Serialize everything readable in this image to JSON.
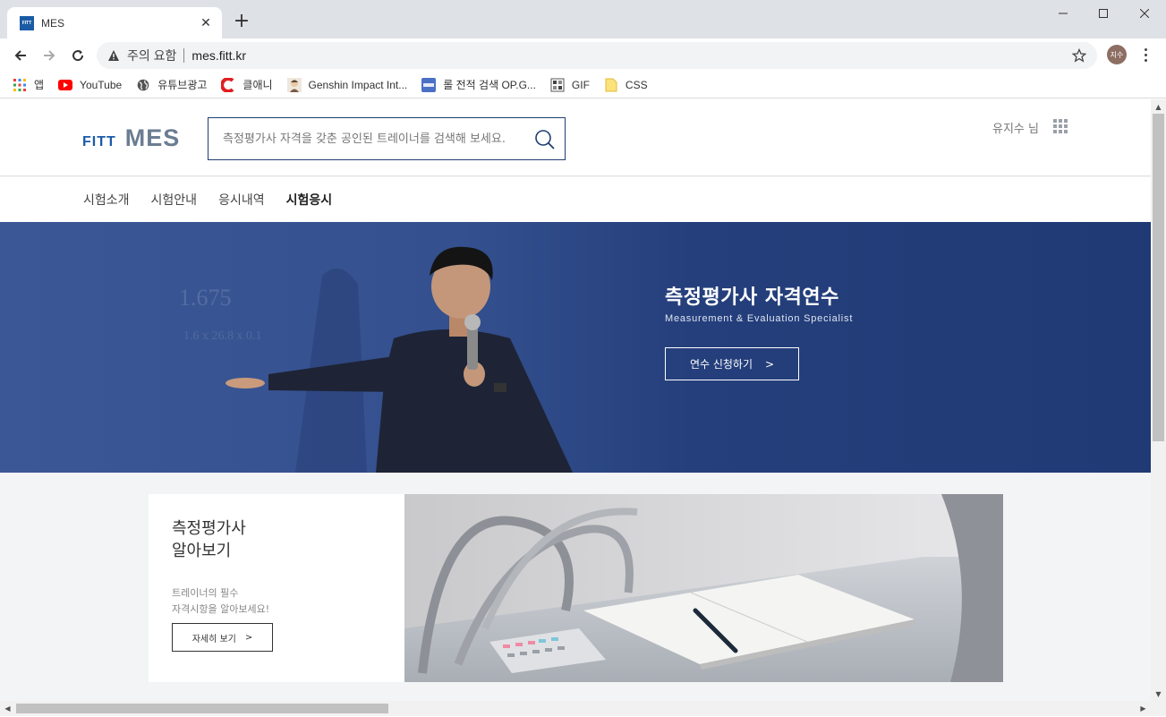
{
  "browser": {
    "tab_title": "MES",
    "tab_favicon_text": "FITT",
    "new_tab": "+",
    "security_label": "주의 요함",
    "url": "mes.fitt.kr",
    "profile_initials": "지수",
    "bookmarks": [
      {
        "label": "앱",
        "icon": "apps-icon"
      },
      {
        "label": "YouTube",
        "icon": "youtube-icon"
      },
      {
        "label": "유튜브광고",
        "icon": "globe-icon"
      },
      {
        "label": "클애니",
        "icon": "c-logo-icon"
      },
      {
        "label": "Genshin Impact Int...",
        "icon": "character-icon"
      },
      {
        "label": "롤 전적 검색 OP.G...",
        "icon": "opgg-icon"
      },
      {
        "label": "GIF",
        "icon": "gif-icon"
      },
      {
        "label": "CSS",
        "icon": "folder-icon"
      }
    ]
  },
  "site": {
    "logo_fitt": "FITT",
    "logo_mes": "MES",
    "search_placeholder": "측정평가사 자격을 갖춘 공인된 트레이너를 검색해 보세요.",
    "user_name": "유지수 님",
    "nav": [
      "시험소개",
      "시험안내",
      "응시내역",
      "시험응시"
    ],
    "nav_active_index": 3
  },
  "hero": {
    "title": "측정평가사 자격연수",
    "subtitle": "Measurement & Evaluation Specialist",
    "button_label": "연수 신청하기",
    "button_arrow": ">",
    "bg_formula_1": "1.675",
    "bg_formula_2": "1.6 x 26.8 x 0.1"
  },
  "card": {
    "title_line1": "측정평가사",
    "title_line2": "알아보기",
    "desc_line1": "트레이너의 필수",
    "desc_line2": "자격시항을 알아보세요!",
    "button_label": "자세히 보기",
    "button_arrow": ">"
  },
  "colors": {
    "brand_blue": "#1a5ba6",
    "hero_bg": "#2a457f",
    "page_bg": "#f3f4f6"
  }
}
